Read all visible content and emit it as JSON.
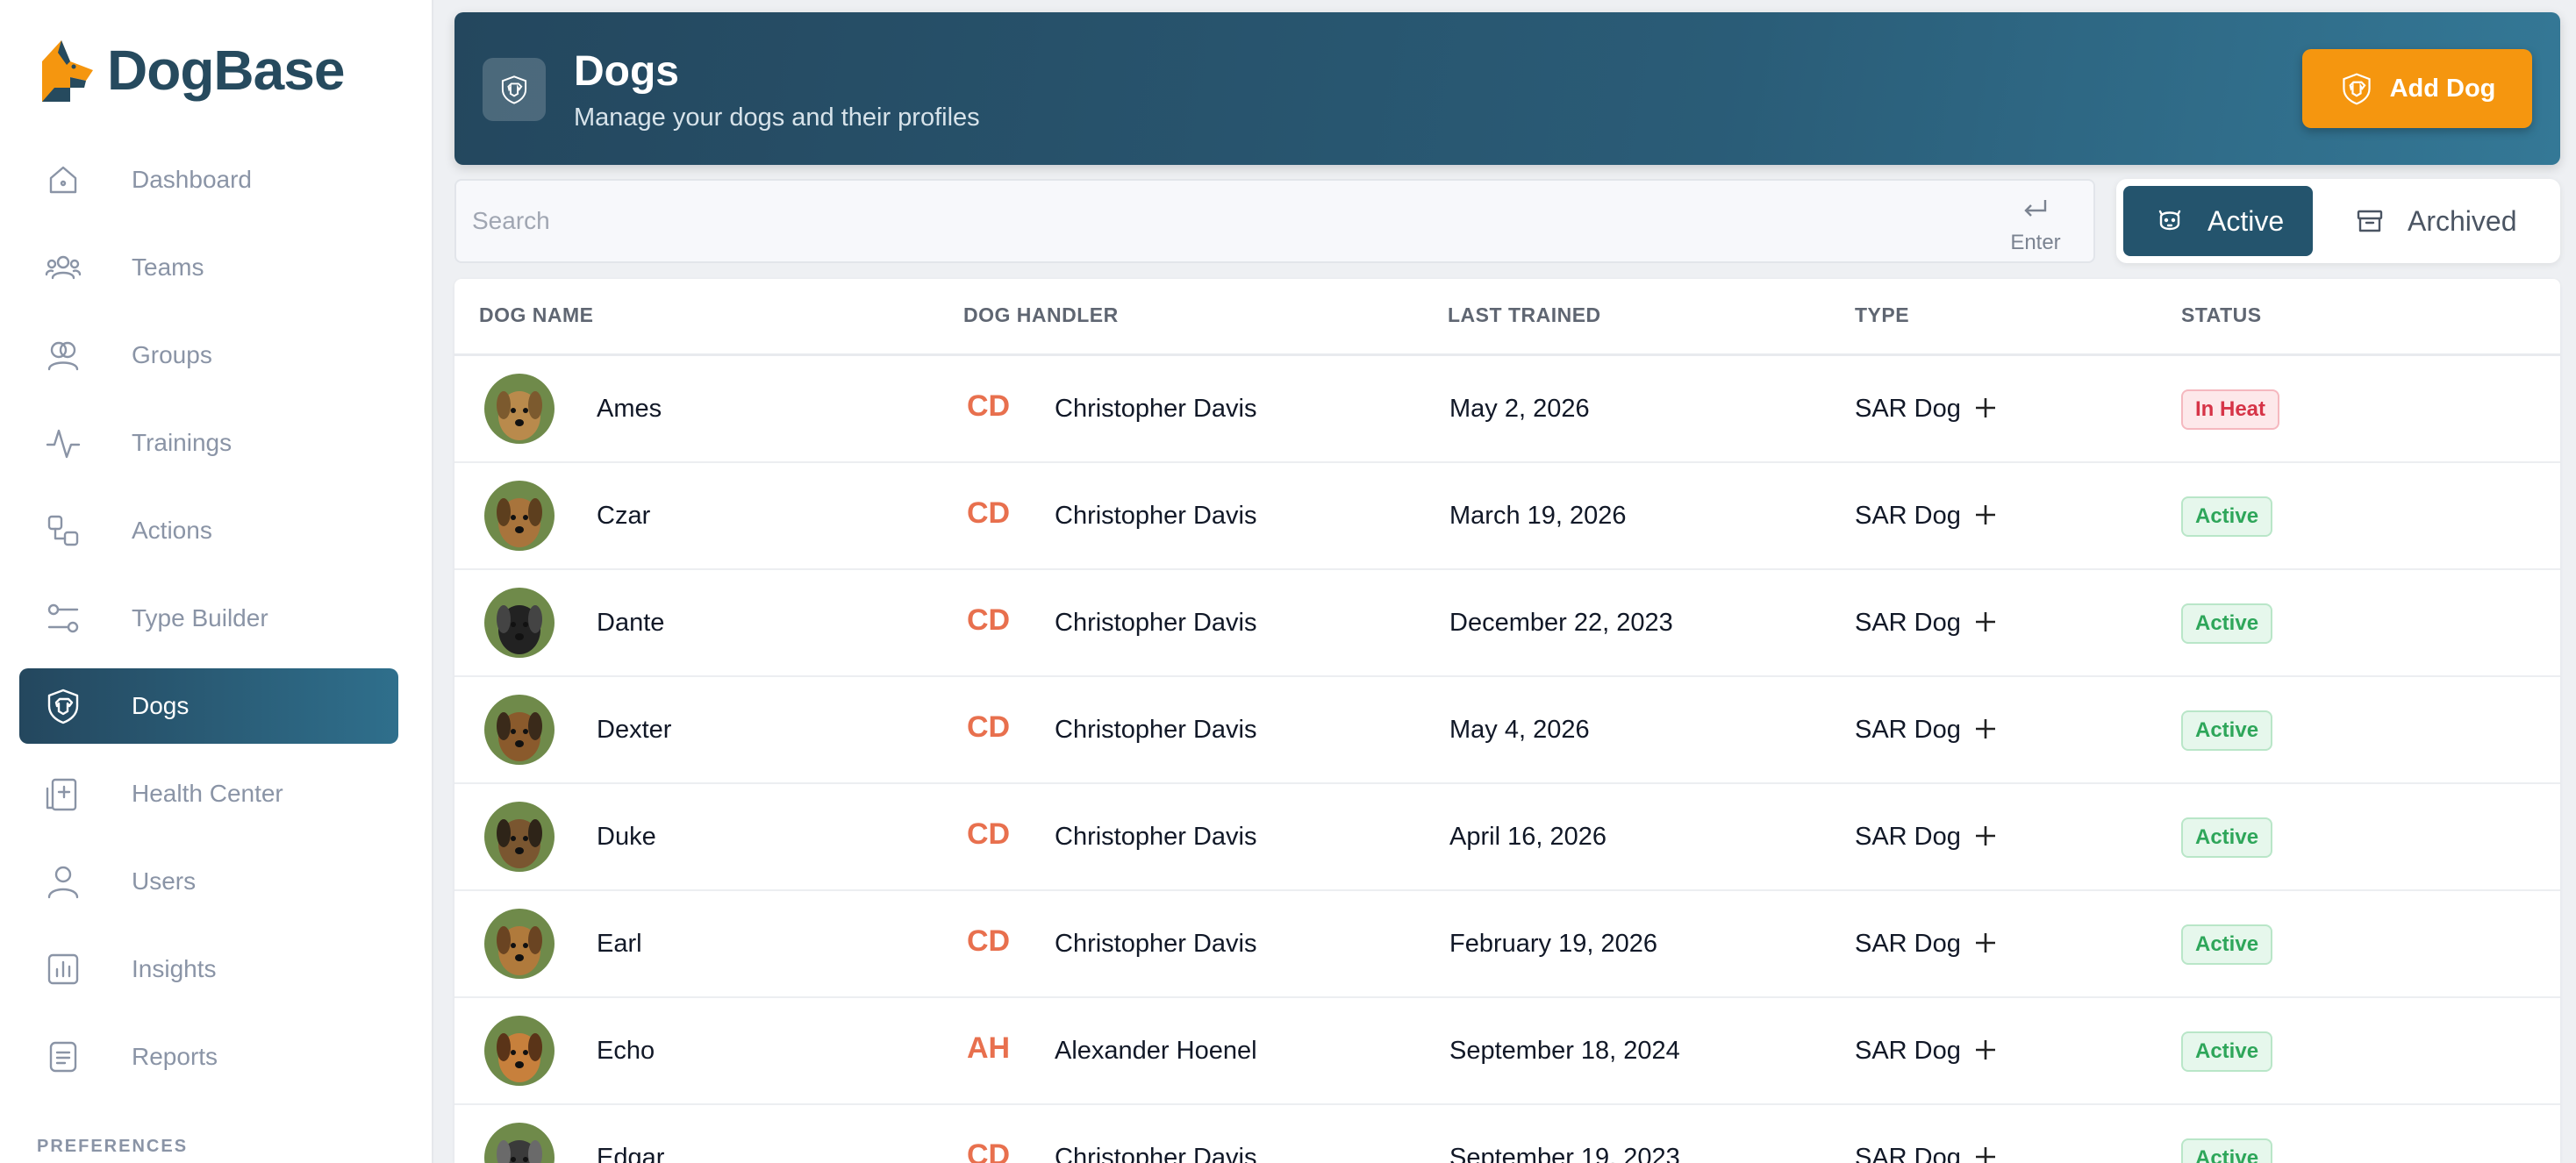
{
  "app": {
    "name": "DogBase"
  },
  "sidebar": {
    "items": [
      {
        "label": "Dashboard",
        "icon": "home-icon"
      },
      {
        "label": "Teams",
        "icon": "team-icon"
      },
      {
        "label": "Groups",
        "icon": "groups-icon"
      },
      {
        "label": "Trainings",
        "icon": "pulse-icon"
      },
      {
        "label": "Actions",
        "icon": "actions-icon"
      },
      {
        "label": "Type Builder",
        "icon": "sliders-icon"
      },
      {
        "label": "Dogs",
        "icon": "dog-shield-icon",
        "active": true
      },
      {
        "label": "Health Center",
        "icon": "clipboard-plus-icon"
      },
      {
        "label": "Users",
        "icon": "user-icon"
      },
      {
        "label": "Insights",
        "icon": "chart-icon"
      },
      {
        "label": "Reports",
        "icon": "report-icon"
      }
    ],
    "section_label": "PREFERENCES"
  },
  "header": {
    "title": "Dogs",
    "subtitle": "Manage your dogs and their profiles",
    "add_label": "Add Dog"
  },
  "search": {
    "placeholder": "Search",
    "value": "",
    "enter_label": "Enter"
  },
  "toggle": {
    "active_label": "Active",
    "archived_label": "Archived",
    "selected": "Active"
  },
  "table": {
    "columns": [
      "DOG NAME",
      "DOG HANDLER",
      "LAST TRAINED",
      "TYPE",
      "STATUS"
    ],
    "rows": [
      {
        "name": "Ames",
        "initials": "CD",
        "handler": "Christopher Davis",
        "last_trained": "May 2, 2026",
        "type": "SAR Dog",
        "status": "In Heat"
      },
      {
        "name": "Czar",
        "initials": "CD",
        "handler": "Christopher Davis",
        "last_trained": "March 19, 2026",
        "type": "SAR Dog",
        "status": "Active"
      },
      {
        "name": "Dante",
        "initials": "CD",
        "handler": "Christopher Davis",
        "last_trained": "December 22, 2023",
        "type": "SAR Dog",
        "status": "Active"
      },
      {
        "name": "Dexter",
        "initials": "CD",
        "handler": "Christopher Davis",
        "last_trained": "May 4, 2026",
        "type": "SAR Dog",
        "status": "Active"
      },
      {
        "name": "Duke",
        "initials": "CD",
        "handler": "Christopher Davis",
        "last_trained": "April 16, 2026",
        "type": "SAR Dog",
        "status": "Active"
      },
      {
        "name": "Earl",
        "initials": "CD",
        "handler": "Christopher Davis",
        "last_trained": "February 19, 2026",
        "type": "SAR Dog",
        "status": "Active"
      },
      {
        "name": "Echo",
        "initials": "AH",
        "handler": "Alexander Hoenel",
        "last_trained": "September 18, 2024",
        "type": "SAR Dog",
        "status": "Active"
      },
      {
        "name": "Edgar",
        "initials": "CD",
        "handler": "Christopher Davis",
        "last_trained": "September 19, 2023",
        "type": "SAR Dog",
        "status": "Active"
      }
    ]
  },
  "colors": {
    "brand_dark": "#24475e",
    "brand_accent": "#f5960f",
    "initials": "#e8704e",
    "status_active": "#2ea65a",
    "status_heat": "#d63447"
  }
}
